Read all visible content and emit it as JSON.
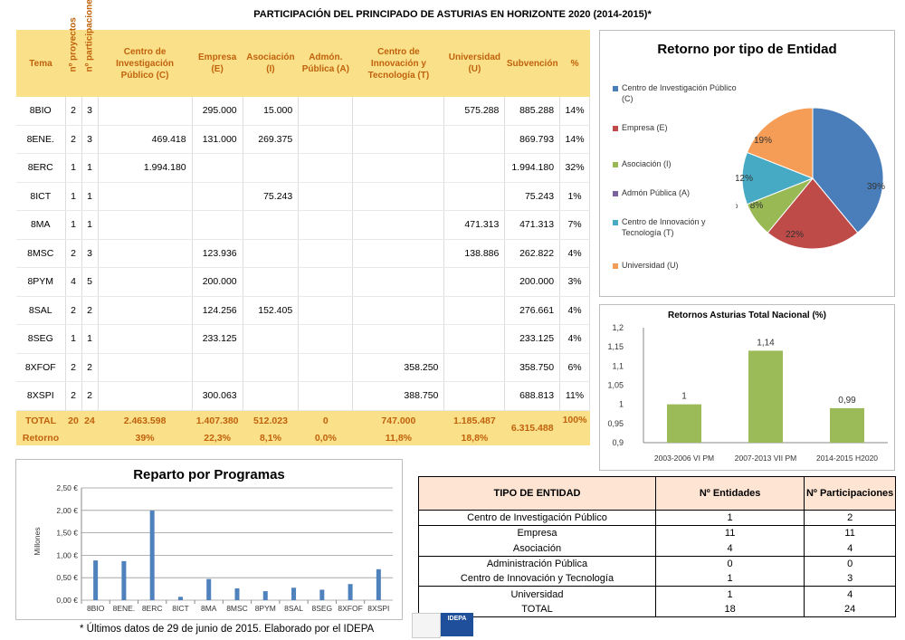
{
  "title": "PARTICIPACIÓN DEL PRINCIPADO DE ASTURIAS EN HORIZONTE 2020 (2014-2015)*",
  "main_table": {
    "headers": [
      "Tema",
      "nº proyectos",
      "nº participaciones",
      "Centro de Investigación Público (C)",
      "Empresa (E)",
      "Asociación (I)",
      "Admón. Pública (A)",
      "Centro de Innovación y Tecnología (T)",
      "Universidad (U)",
      "Subvención",
      "%"
    ],
    "rows": [
      [
        "8BIO",
        "2",
        "3",
        "",
        "295.000",
        "15.000",
        "",
        "",
        "575.288",
        "885.288",
        "14%"
      ],
      [
        "8ENE.",
        "2",
        "3",
        "469.418",
        "131.000",
        "269.375",
        "",
        "",
        "",
        "869.793",
        "14%"
      ],
      [
        "8ERC",
        "1",
        "1",
        "1.994.180",
        "",
        "",
        "",
        "",
        "",
        "1.994.180",
        "32%"
      ],
      [
        "8ICT",
        "1",
        "1",
        "",
        "",
        "75.243",
        "",
        "",
        "",
        "75.243",
        "1%"
      ],
      [
        "8MA",
        "1",
        "1",
        "",
        "",
        "",
        "",
        "",
        "471.313",
        "471.313",
        "7%"
      ],
      [
        "8MSC",
        "2",
        "3",
        "",
        "123.936",
        "",
        "",
        "",
        "138.886",
        "262.822",
        "4%"
      ],
      [
        "8PYM",
        "4",
        "5",
        "",
        "200.000",
        "",
        "",
        "",
        "",
        "200.000",
        "3%"
      ],
      [
        "8SAL",
        "2",
        "2",
        "",
        "124.256",
        "152.405",
        "",
        "",
        "",
        "276.661",
        "4%"
      ],
      [
        "8SEG",
        "1",
        "1",
        "",
        "233.125",
        "",
        "",
        "",
        "",
        "233.125",
        "4%"
      ],
      [
        "8XFOF",
        "2",
        "2",
        "",
        "",
        "",
        "",
        "358.250",
        "",
        "358.750",
        "6%"
      ],
      [
        "8XSPI",
        "2",
        "2",
        "",
        "300.063",
        "",
        "",
        "388.750",
        "",
        "688.813",
        "11%"
      ]
    ],
    "total": [
      "TOTAL",
      "20",
      "24",
      "2.463.598",
      "1.407.380",
      "512.023",
      "0",
      "747.000",
      "1.185.487",
      "6.315.488",
      "100%"
    ],
    "retorno": [
      "Retorno",
      "",
      "",
      "39%",
      "22,3%",
      "8,1%",
      "0,0%",
      "11,8%",
      "18,8%"
    ]
  },
  "chart_data": [
    {
      "type": "pie",
      "title": "Retorno por tipo de Entidad",
      "categories": [
        "Centro de Investigación Público (C)",
        "Empresa (E)",
        "Asociación (I)",
        "Admón Pública (A)",
        "Centro de Innovación y Tecnología (T)",
        "Universidad (U)"
      ],
      "values": [
        39,
        22,
        8,
        0,
        12,
        19
      ],
      "labels": [
        "39%",
        "22%",
        "8%",
        "0%",
        "12%",
        "19%"
      ],
      "colors": [
        "#4a7ebb",
        "#be4b48",
        "#98b954",
        "#7d60a0",
        "#46aac5",
        "#f59d56"
      ],
      "legend": "left"
    },
    {
      "type": "bar",
      "title": "Retornos Asturias Total Nacional (%)",
      "categories": [
        "2003-2006 VI PM",
        "2007-2013 VII PM",
        "2014-2015 H2020"
      ],
      "values": [
        1,
        1.14,
        0.99
      ],
      "labels": [
        "1",
        "1,14",
        "0,99"
      ],
      "ylim": [
        0.9,
        1.2
      ],
      "yticks": [
        "0,9",
        "0,95",
        "1",
        "1,05",
        "1,1",
        "1,15",
        "1,2"
      ],
      "color": "#9bbb59"
    },
    {
      "type": "bar",
      "title": "Reparto por Programas",
      "ylabel": "Millones",
      "categories": [
        "8BIO",
        "8ENE.",
        "8ERC",
        "8ICT",
        "8MA",
        "8MSC",
        "8PYM",
        "8SAL",
        "8SEG",
        "8XFOF",
        "8XSPI"
      ],
      "values": [
        0.885,
        0.87,
        1.994,
        0.075,
        0.471,
        0.263,
        0.2,
        0.277,
        0.233,
        0.359,
        0.689
      ],
      "ylim": [
        0,
        2.5
      ],
      "yticks": [
        "0,00 €",
        "0,50 €",
        "1,00 €",
        "1,50 €",
        "2,00 €",
        "2,50 €"
      ],
      "color": "#4f81bd"
    }
  ],
  "entity_table": {
    "headers": [
      "TIPO DE ENTIDAD",
      "Nº Entidades",
      "Nº Participaciones"
    ],
    "rows": [
      [
        "Centro de Investigación Público",
        "1",
        "2"
      ],
      [
        "Empresa",
        "11",
        "11"
      ],
      [
        "Asociación",
        "4",
        "4"
      ],
      [
        "Administración Pública",
        "0",
        "0"
      ],
      [
        "Centro de Innovación y Tecnología",
        "1",
        "3"
      ],
      [
        "Universidad",
        "1",
        "4"
      ],
      [
        "TOTAL",
        "18",
        "24"
      ]
    ]
  },
  "footnote": "* Últimos datos de 29 de junio de 2015. Elaborado por el IDEPA",
  "logo_text": "IDEPA"
}
